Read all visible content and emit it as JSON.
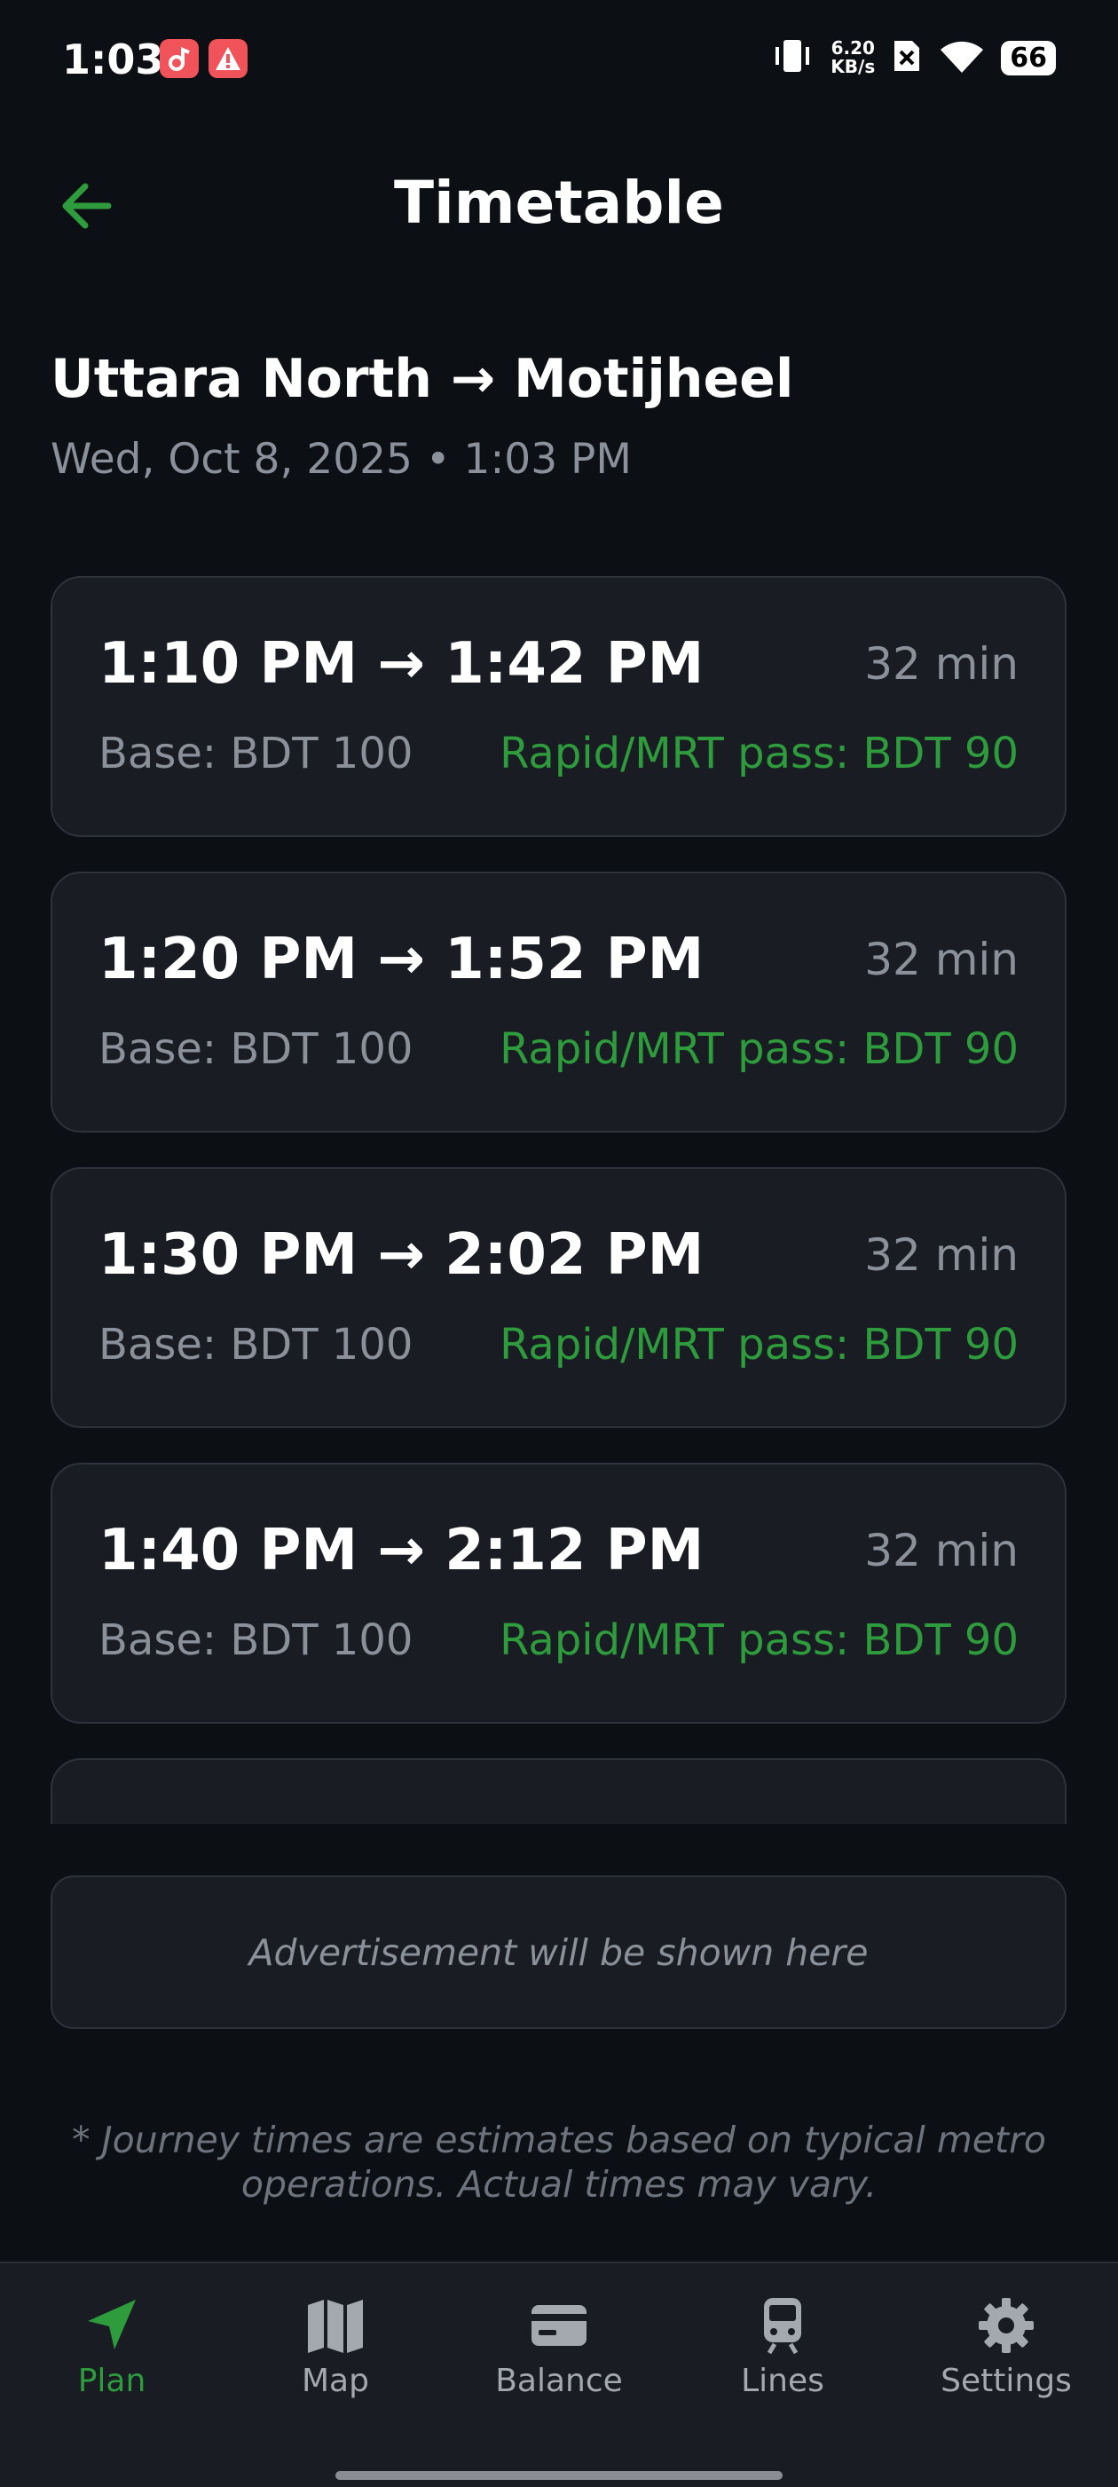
{
  "status_bar": {
    "time": "1:03",
    "net_speed_value": "6.20",
    "net_speed_unit": "KB/s",
    "battery": "66"
  },
  "header": {
    "title": "Timetable",
    "back_icon": "arrow-left-icon"
  },
  "route": {
    "title": "Uttara North → Motijheel",
    "datetime": "Wed, Oct 8, 2025 • 1:03 PM"
  },
  "trips": [
    {
      "times": "1:10 PM → 1:42 PM",
      "duration": "32 min",
      "base": "Base: BDT 100",
      "pass": "Rapid/MRT pass: BDT 90"
    },
    {
      "times": "1:20 PM → 1:52 PM",
      "duration": "32 min",
      "base": "Base: BDT 100",
      "pass": "Rapid/MRT pass: BDT 90"
    },
    {
      "times": "1:30 PM → 2:02 PM",
      "duration": "32 min",
      "base": "Base: BDT 100",
      "pass": "Rapid/MRT pass: BDT 90"
    },
    {
      "times": "1:40 PM → 2:12 PM",
      "duration": "32 min",
      "base": "Base: BDT 100",
      "pass": "Rapid/MRT pass: BDT 90"
    }
  ],
  "ad": {
    "text": "Advertisement will be shown here"
  },
  "disclaimer": "* Journey times are estimates based on typical metro operations. Actual times may vary.",
  "bottom_nav": [
    {
      "label": "Plan",
      "icon": "navigation-arrow-icon",
      "active": true
    },
    {
      "label": "Map",
      "icon": "map-icon",
      "active": false
    },
    {
      "label": "Balance",
      "icon": "card-icon",
      "active": false
    },
    {
      "label": "Lines",
      "icon": "train-icon",
      "active": false
    },
    {
      "label": "Settings",
      "icon": "gear-icon",
      "active": false
    }
  ],
  "colors": {
    "background": "#0c0f14",
    "card": "#191c22",
    "accent_green": "#2e9b3d",
    "muted_text": "#8b919a"
  }
}
